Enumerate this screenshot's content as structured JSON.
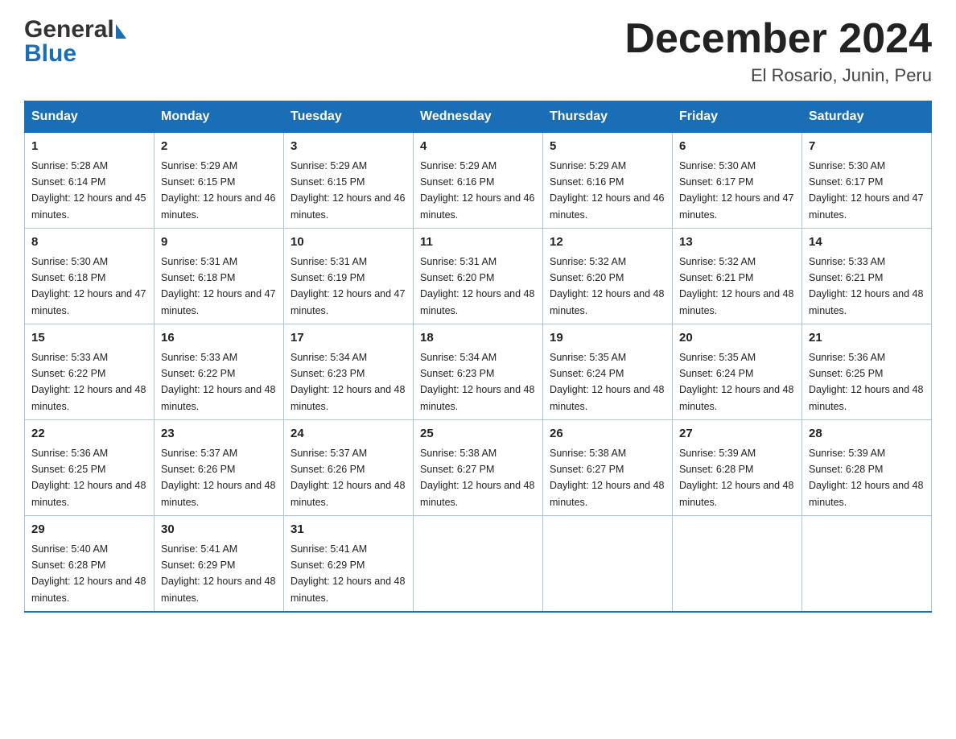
{
  "logo": {
    "general": "General",
    "blue": "Blue"
  },
  "title": "December 2024",
  "subtitle": "El Rosario, Junin, Peru",
  "weekdays": [
    "Sunday",
    "Monday",
    "Tuesday",
    "Wednesday",
    "Thursday",
    "Friday",
    "Saturday"
  ],
  "weeks": [
    [
      {
        "day": "1",
        "sunrise": "5:28 AM",
        "sunset": "6:14 PM",
        "daylight": "12 hours and 45 minutes."
      },
      {
        "day": "2",
        "sunrise": "5:29 AM",
        "sunset": "6:15 PM",
        "daylight": "12 hours and 46 minutes."
      },
      {
        "day": "3",
        "sunrise": "5:29 AM",
        "sunset": "6:15 PM",
        "daylight": "12 hours and 46 minutes."
      },
      {
        "day": "4",
        "sunrise": "5:29 AM",
        "sunset": "6:16 PM",
        "daylight": "12 hours and 46 minutes."
      },
      {
        "day": "5",
        "sunrise": "5:29 AM",
        "sunset": "6:16 PM",
        "daylight": "12 hours and 46 minutes."
      },
      {
        "day": "6",
        "sunrise": "5:30 AM",
        "sunset": "6:17 PM",
        "daylight": "12 hours and 47 minutes."
      },
      {
        "day": "7",
        "sunrise": "5:30 AM",
        "sunset": "6:17 PM",
        "daylight": "12 hours and 47 minutes."
      }
    ],
    [
      {
        "day": "8",
        "sunrise": "5:30 AM",
        "sunset": "6:18 PM",
        "daylight": "12 hours and 47 minutes."
      },
      {
        "day": "9",
        "sunrise": "5:31 AM",
        "sunset": "6:18 PM",
        "daylight": "12 hours and 47 minutes."
      },
      {
        "day": "10",
        "sunrise": "5:31 AM",
        "sunset": "6:19 PM",
        "daylight": "12 hours and 47 minutes."
      },
      {
        "day": "11",
        "sunrise": "5:31 AM",
        "sunset": "6:20 PM",
        "daylight": "12 hours and 48 minutes."
      },
      {
        "day": "12",
        "sunrise": "5:32 AM",
        "sunset": "6:20 PM",
        "daylight": "12 hours and 48 minutes."
      },
      {
        "day": "13",
        "sunrise": "5:32 AM",
        "sunset": "6:21 PM",
        "daylight": "12 hours and 48 minutes."
      },
      {
        "day": "14",
        "sunrise": "5:33 AM",
        "sunset": "6:21 PM",
        "daylight": "12 hours and 48 minutes."
      }
    ],
    [
      {
        "day": "15",
        "sunrise": "5:33 AM",
        "sunset": "6:22 PM",
        "daylight": "12 hours and 48 minutes."
      },
      {
        "day": "16",
        "sunrise": "5:33 AM",
        "sunset": "6:22 PM",
        "daylight": "12 hours and 48 minutes."
      },
      {
        "day": "17",
        "sunrise": "5:34 AM",
        "sunset": "6:23 PM",
        "daylight": "12 hours and 48 minutes."
      },
      {
        "day": "18",
        "sunrise": "5:34 AM",
        "sunset": "6:23 PM",
        "daylight": "12 hours and 48 minutes."
      },
      {
        "day": "19",
        "sunrise": "5:35 AM",
        "sunset": "6:24 PM",
        "daylight": "12 hours and 48 minutes."
      },
      {
        "day": "20",
        "sunrise": "5:35 AM",
        "sunset": "6:24 PM",
        "daylight": "12 hours and 48 minutes."
      },
      {
        "day": "21",
        "sunrise": "5:36 AM",
        "sunset": "6:25 PM",
        "daylight": "12 hours and 48 minutes."
      }
    ],
    [
      {
        "day": "22",
        "sunrise": "5:36 AM",
        "sunset": "6:25 PM",
        "daylight": "12 hours and 48 minutes."
      },
      {
        "day": "23",
        "sunrise": "5:37 AM",
        "sunset": "6:26 PM",
        "daylight": "12 hours and 48 minutes."
      },
      {
        "day": "24",
        "sunrise": "5:37 AM",
        "sunset": "6:26 PM",
        "daylight": "12 hours and 48 minutes."
      },
      {
        "day": "25",
        "sunrise": "5:38 AM",
        "sunset": "6:27 PM",
        "daylight": "12 hours and 48 minutes."
      },
      {
        "day": "26",
        "sunrise": "5:38 AM",
        "sunset": "6:27 PM",
        "daylight": "12 hours and 48 minutes."
      },
      {
        "day": "27",
        "sunrise": "5:39 AM",
        "sunset": "6:28 PM",
        "daylight": "12 hours and 48 minutes."
      },
      {
        "day": "28",
        "sunrise": "5:39 AM",
        "sunset": "6:28 PM",
        "daylight": "12 hours and 48 minutes."
      }
    ],
    [
      {
        "day": "29",
        "sunrise": "5:40 AM",
        "sunset": "6:28 PM",
        "daylight": "12 hours and 48 minutes."
      },
      {
        "day": "30",
        "sunrise": "5:41 AM",
        "sunset": "6:29 PM",
        "daylight": "12 hours and 48 minutes."
      },
      {
        "day": "31",
        "sunrise": "5:41 AM",
        "sunset": "6:29 PM",
        "daylight": "12 hours and 48 minutes."
      },
      null,
      null,
      null,
      null
    ]
  ]
}
